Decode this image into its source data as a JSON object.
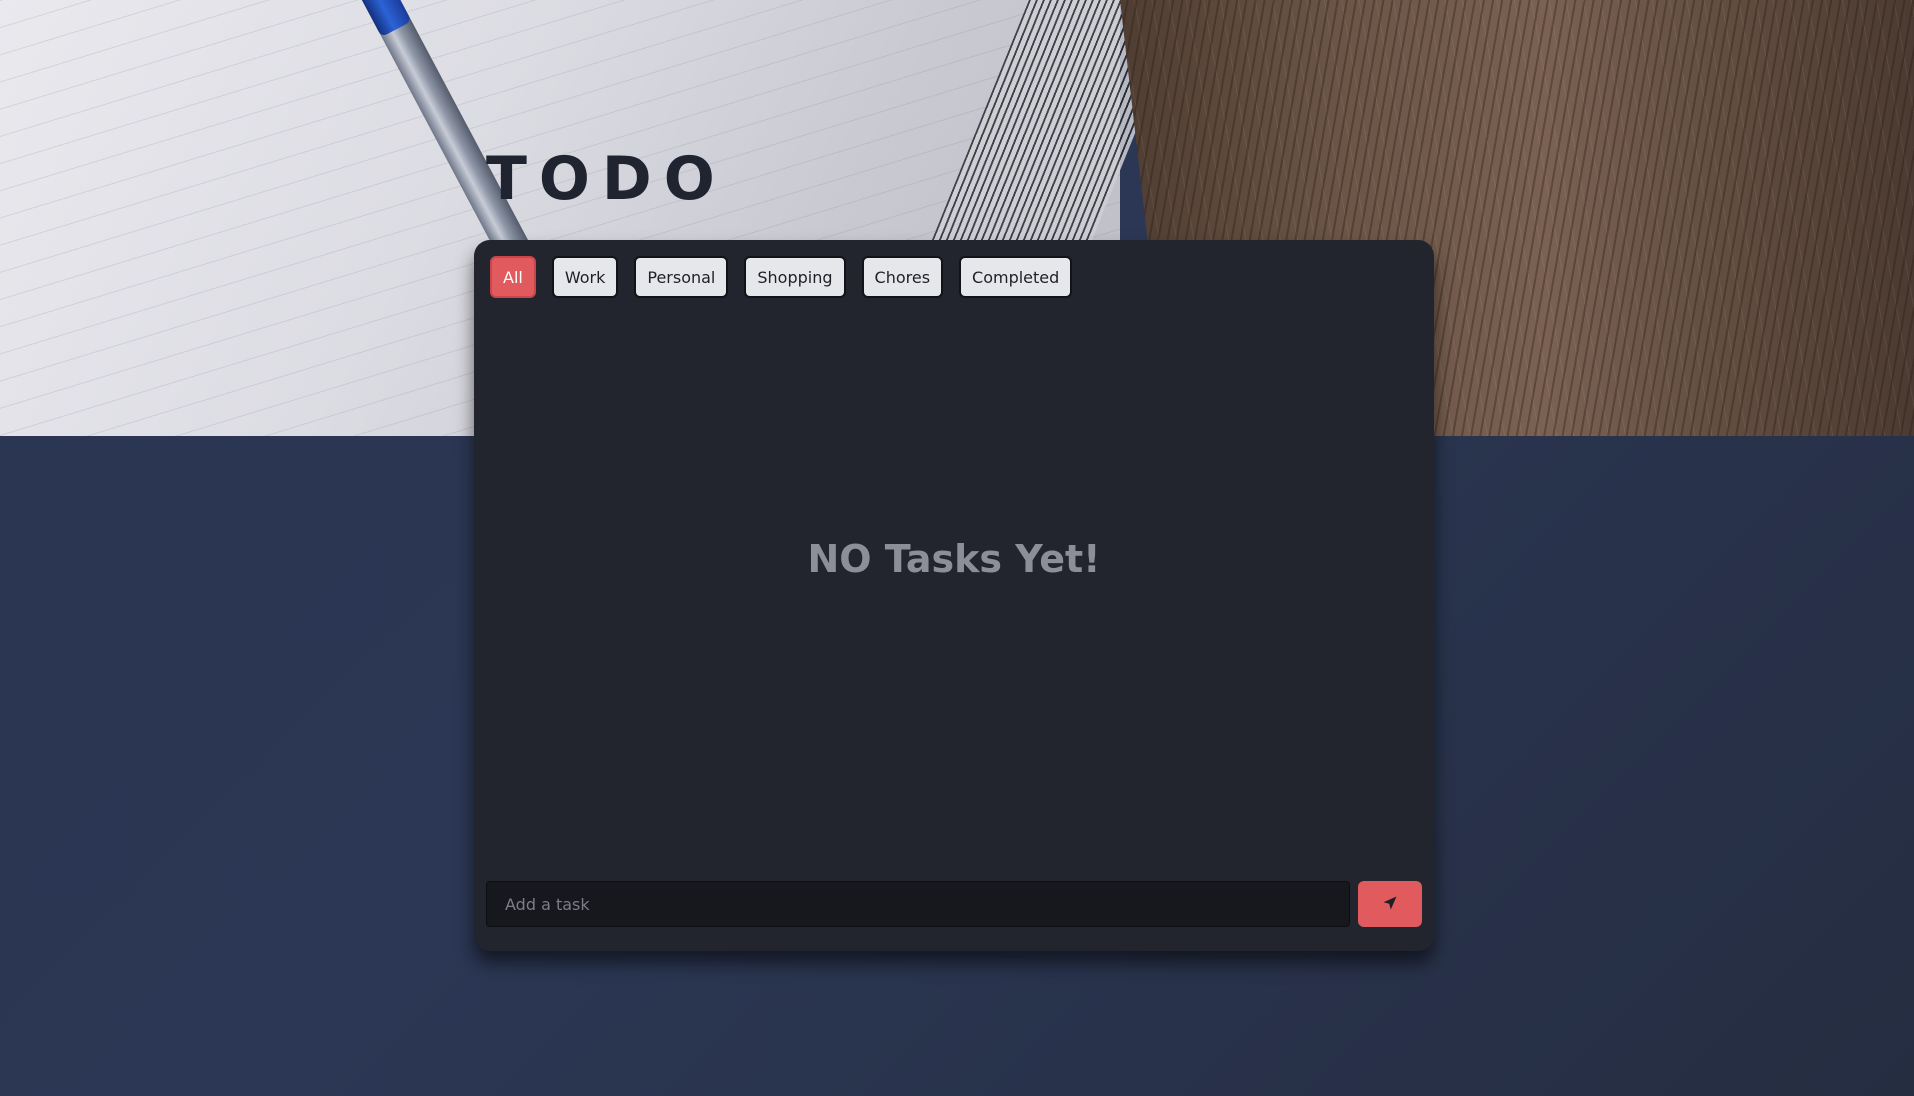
{
  "app": {
    "title": "TODO"
  },
  "filters": [
    {
      "label": "All",
      "active": true
    },
    {
      "label": "Work",
      "active": false
    },
    {
      "label": "Personal",
      "active": false
    },
    {
      "label": "Shopping",
      "active": false
    },
    {
      "label": "Chores",
      "active": false
    },
    {
      "label": "Completed",
      "active": false
    }
  ],
  "tasks": {
    "empty_message": "NO Tasks Yet!"
  },
  "add_task": {
    "value": "",
    "placeholder": "Add a task",
    "submit_icon": "send-icon"
  },
  "colors": {
    "accent": "#e05a5e",
    "card_background": "#22252e",
    "page_background": "#2a3550",
    "title": "#1f2430"
  }
}
